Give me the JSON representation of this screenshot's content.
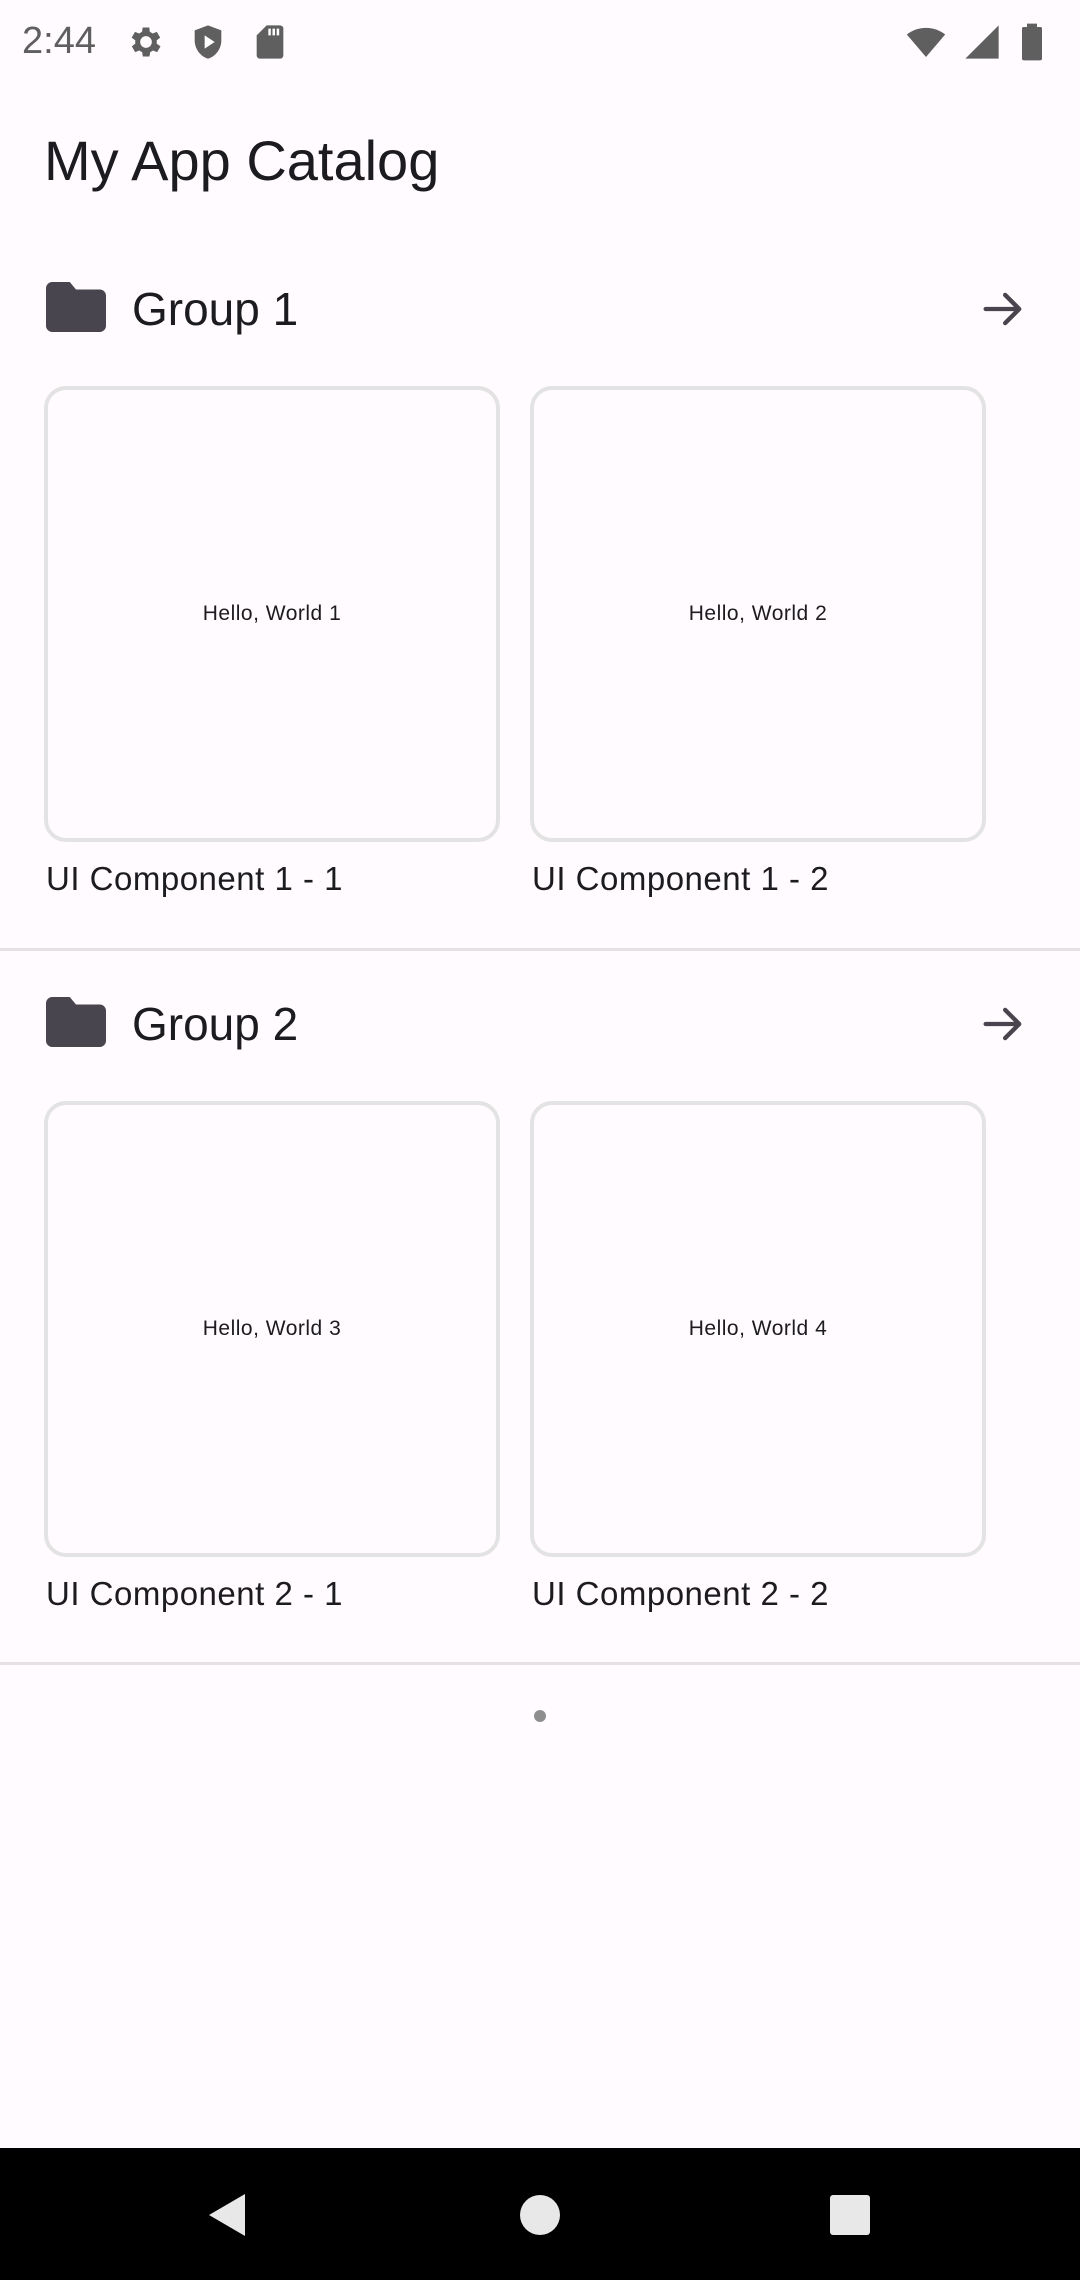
{
  "status_bar": {
    "time": "2:44",
    "left_icons": [
      "settings-icon",
      "shield-icon",
      "sd-card-icon"
    ],
    "right_icons": [
      "wifi-icon",
      "cellular-signal-icon",
      "battery-icon"
    ]
  },
  "app": {
    "title": "My App Catalog"
  },
  "groups": [
    {
      "title": "Group 1",
      "components": [
        {
          "preview_text": "Hello, World 1",
          "label": "UI Component 1 - 1"
        },
        {
          "preview_text": "Hello, World 2",
          "label": "UI Component 1 - 2"
        }
      ]
    },
    {
      "title": "Group 2",
      "components": [
        {
          "preview_text": "Hello, World 3",
          "label": "UI Component 2 - 1"
        },
        {
          "preview_text": "Hello, World 4",
          "label": "UI Component 2 - 2"
        }
      ]
    }
  ],
  "navigation": {
    "buttons": [
      "back-icon",
      "home-icon",
      "recents-icon"
    ]
  },
  "colors": {
    "background": "#fffbfe",
    "text": "#1c1b1f",
    "card_border": "#e3e3e3",
    "divider": "#e6e1e5",
    "icon": "#49454f",
    "nav_bar": "#000000"
  }
}
